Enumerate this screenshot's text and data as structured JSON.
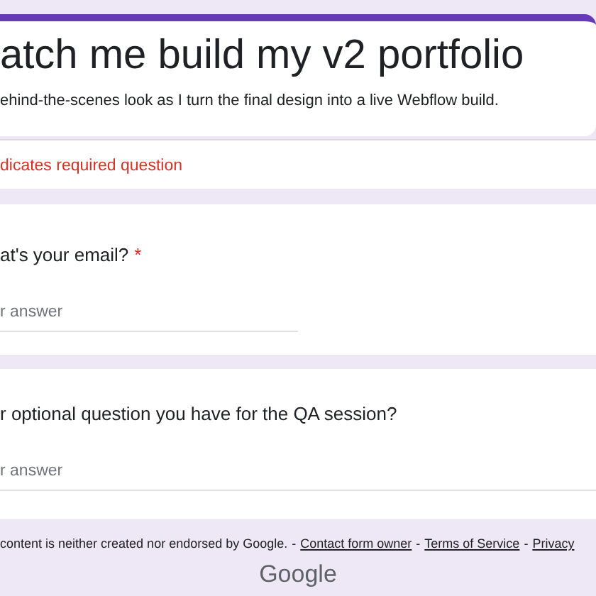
{
  "header": {
    "title": "atch me build my v2 portfolio",
    "description": "ehind-the-scenes look as I turn the final design into a live Webflow build."
  },
  "required_notice": "dicates required question",
  "required_mark": "*",
  "questions": [
    {
      "label": "at's your email?",
      "required": true,
      "placeholder": "r answer"
    },
    {
      "label": "r optional question you have for the QA session?",
      "required": false,
      "placeholder": "r answer"
    }
  ],
  "footer": {
    "text": "content is neither created nor endorsed by Google.",
    "separator": "-",
    "links": [
      "Contact form owner",
      "Terms of Service",
      "Privacy"
    ]
  },
  "logo": "Google"
}
